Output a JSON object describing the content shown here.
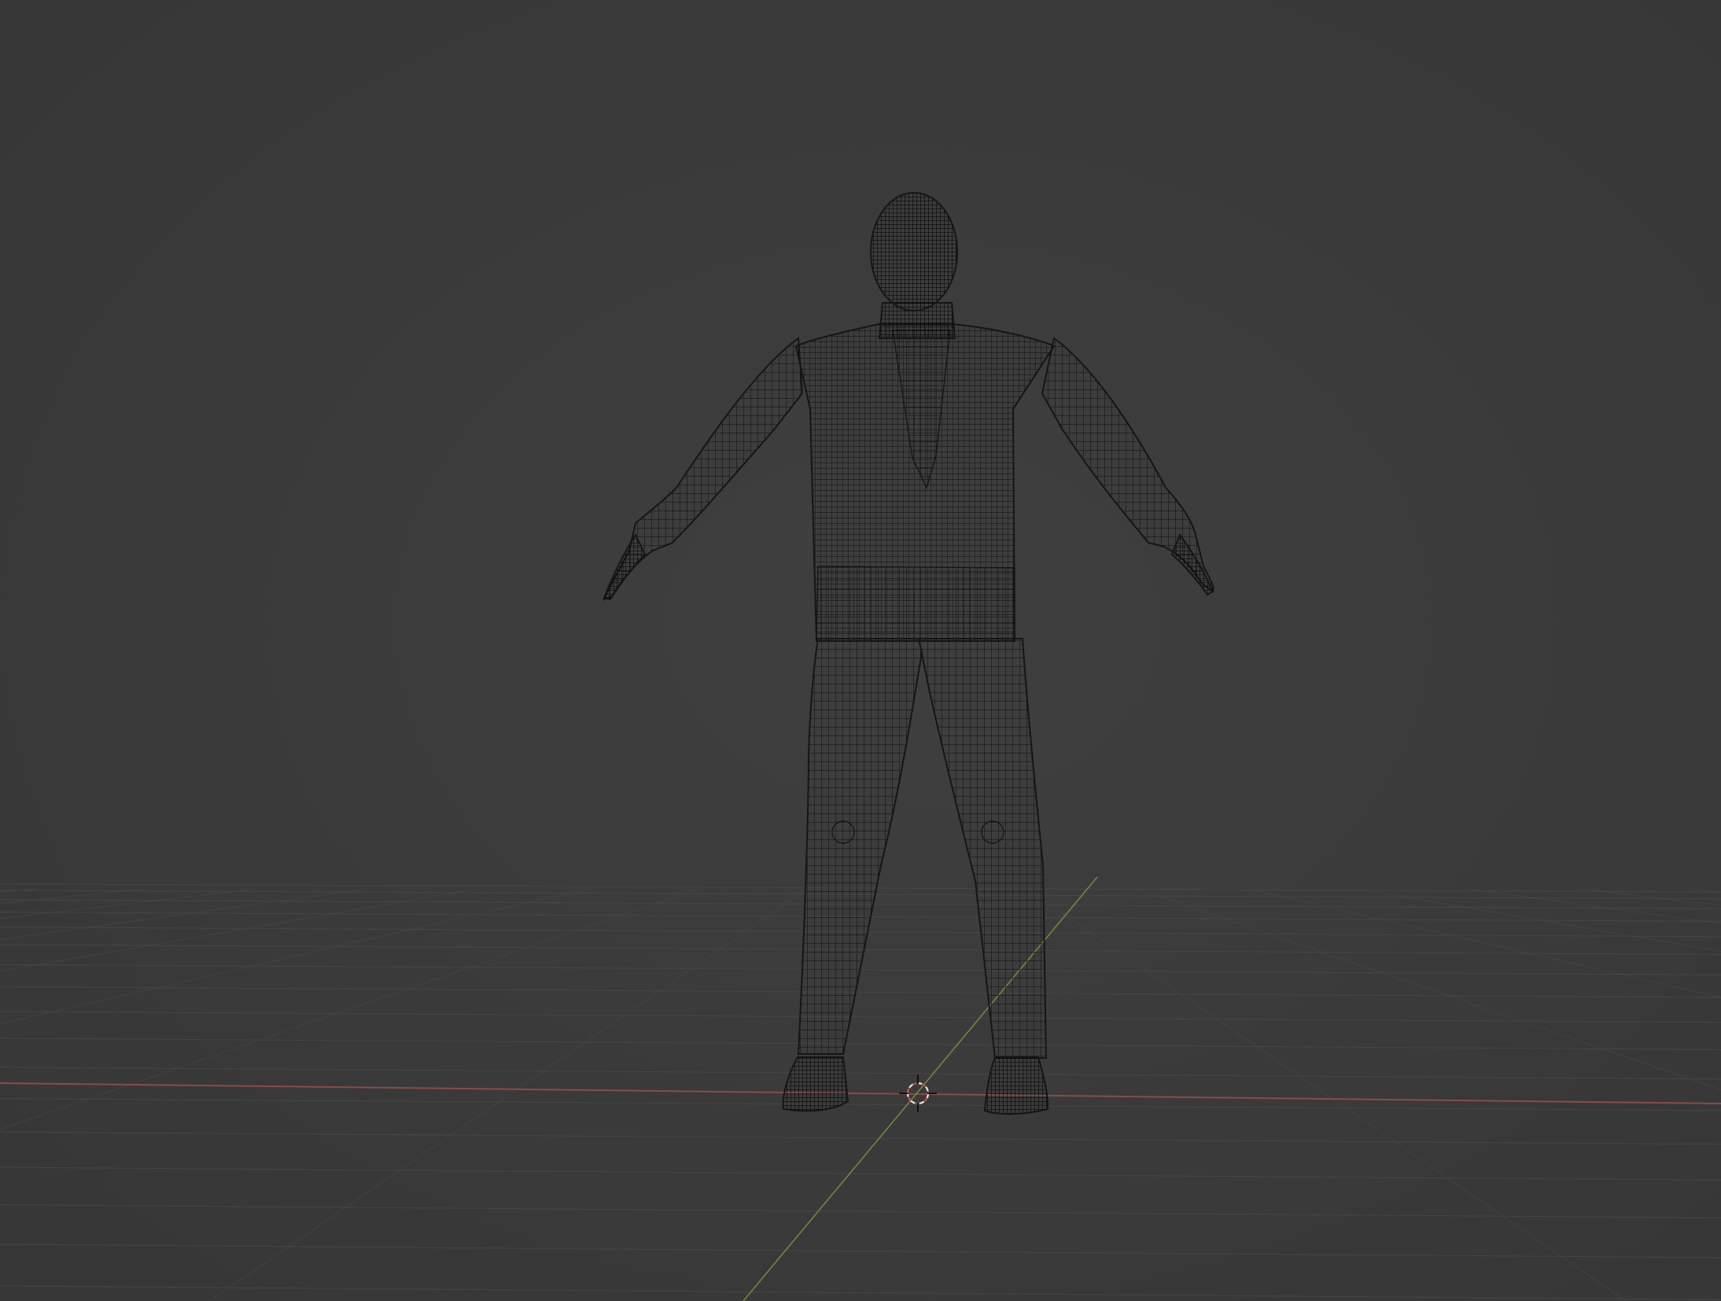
{
  "viewport": {
    "mode": "wireframe",
    "object": "character-mesh",
    "pose": "A-pose",
    "background_color": "#3b3b3b",
    "grid_color": "#474747",
    "x_axis_color": "#8a4a4a",
    "y_axis_color": "#6f8a3a",
    "mesh_color": "#111111",
    "cursor_colors": [
      "#e8e8e8",
      "#d04a4a"
    ]
  }
}
